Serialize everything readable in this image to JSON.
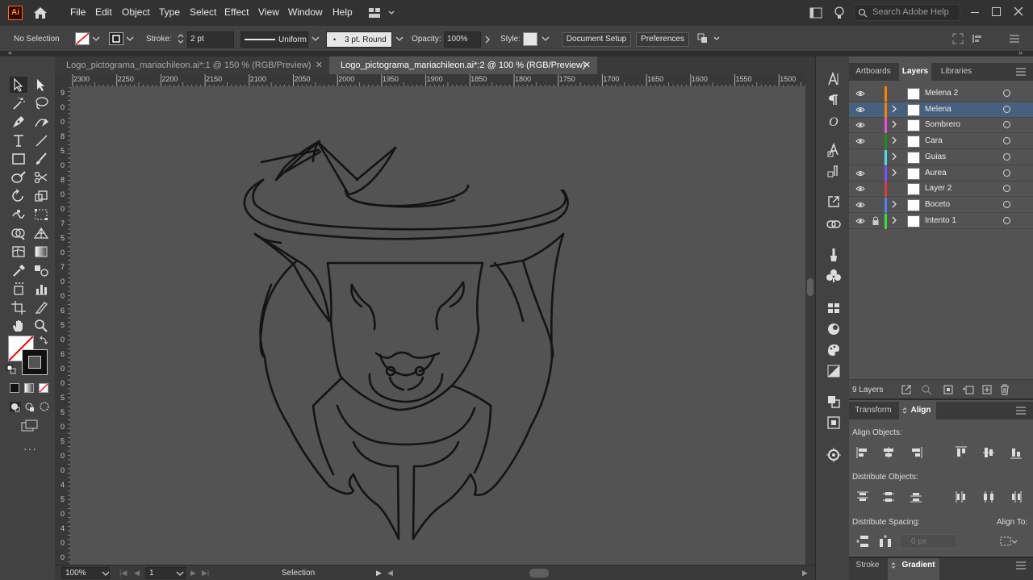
{
  "app": {
    "logo_text": "Ai"
  },
  "menu": {
    "items": [
      "File",
      "Edit",
      "Object",
      "Type",
      "Select",
      "Effect",
      "View",
      "Window",
      "Help"
    ],
    "search_placeholder": "Search Adobe Help"
  },
  "control_bar": {
    "selection_state": "No Selection",
    "stroke_label": "Stroke:",
    "stroke_weight": "2 pt",
    "stroke_profile": "Uniform",
    "brush": "3 pt. Round",
    "opacity_label": "Opacity:",
    "opacity_value": "100%",
    "style_label": "Style:",
    "document_setup": "Document Setup",
    "preferences": "Preferences"
  },
  "documents": {
    "tabs": [
      {
        "label": "Logo_pictograma_mariachileon.ai*:1 @ 150 % (RGB/Preview)",
        "active": false
      },
      {
        "label": "Logo_pictograma_mariachileon.ai*:2 @ 100 % (RGB/Preview)",
        "active": true
      }
    ],
    "close_glyph": "✕"
  },
  "ruler": {
    "horizontal": [
      "2300",
      "2250",
      "2200",
      "2150",
      "2100",
      "2050",
      "2000",
      "1950",
      "1900",
      "1850",
      "1800",
      "1750",
      "1700",
      "1650",
      "1600",
      "1550",
      "1500"
    ],
    "vertical": [
      "9",
      "0",
      "0",
      "8",
      "5",
      "0",
      "8",
      "0",
      "0",
      "7",
      "5",
      "0",
      "7",
      "0",
      "0",
      "6",
      "5",
      "0",
      "6",
      "0",
      "0",
      "5",
      "5",
      "0",
      "5",
      "0",
      "0",
      "4",
      "5",
      "0",
      "4",
      "0",
      "0"
    ]
  },
  "status_bar": {
    "zoom": "100%",
    "artboard": "1",
    "tool": "Selection"
  },
  "layers_panel": {
    "tabs": [
      {
        "label": "Artboards",
        "active": false
      },
      {
        "label": "Layers",
        "active": true
      },
      {
        "label": "Libraries",
        "active": false
      }
    ],
    "layers": [
      {
        "name": "Melena 2",
        "color": "#ff7f00",
        "visible": true,
        "locked": false,
        "expandable": false,
        "selected": false
      },
      {
        "name": "Melena",
        "color": "#ff7f00",
        "visible": true,
        "locked": false,
        "expandable": true,
        "selected": true
      },
      {
        "name": "Sombrero",
        "color": "#e650e6",
        "visible": true,
        "locked": false,
        "expandable": true,
        "selected": false
      },
      {
        "name": "Cara",
        "color": "#1e8c1e",
        "visible": true,
        "locked": false,
        "expandable": true,
        "selected": false
      },
      {
        "name": "Guias",
        "color": "#4fdcf0",
        "visible": false,
        "locked": false,
        "expandable": true,
        "selected": false
      },
      {
        "name": "Aurea",
        "color": "#7a4fff",
        "visible": true,
        "locked": false,
        "expandable": true,
        "selected": false
      },
      {
        "name": "Layer 2",
        "color": "#e03c3c",
        "visible": true,
        "locked": false,
        "expandable": false,
        "selected": false
      },
      {
        "name": "Boceto",
        "color": "#4f7fff",
        "visible": true,
        "locked": false,
        "expandable": true,
        "selected": false
      },
      {
        "name": "Intento 1",
        "color": "#3cdc3c",
        "visible": true,
        "locked": true,
        "expandable": true,
        "selected": false
      }
    ],
    "count": "9 Layers"
  },
  "align_panel": {
    "tabs": [
      {
        "label": "Transform",
        "active": false
      },
      {
        "label": "Align",
        "active": true
      }
    ],
    "align_objects": "Align Objects:",
    "distribute_objects": "Distribute Objects:",
    "distribute_spacing": "Distribute Spacing:",
    "align_to": "Align To:",
    "spacing_value": "0 px"
  },
  "bottom_panel": {
    "tabs": [
      {
        "label": "Stroke",
        "active": false
      },
      {
        "label": "Gradient",
        "active": true
      }
    ]
  }
}
